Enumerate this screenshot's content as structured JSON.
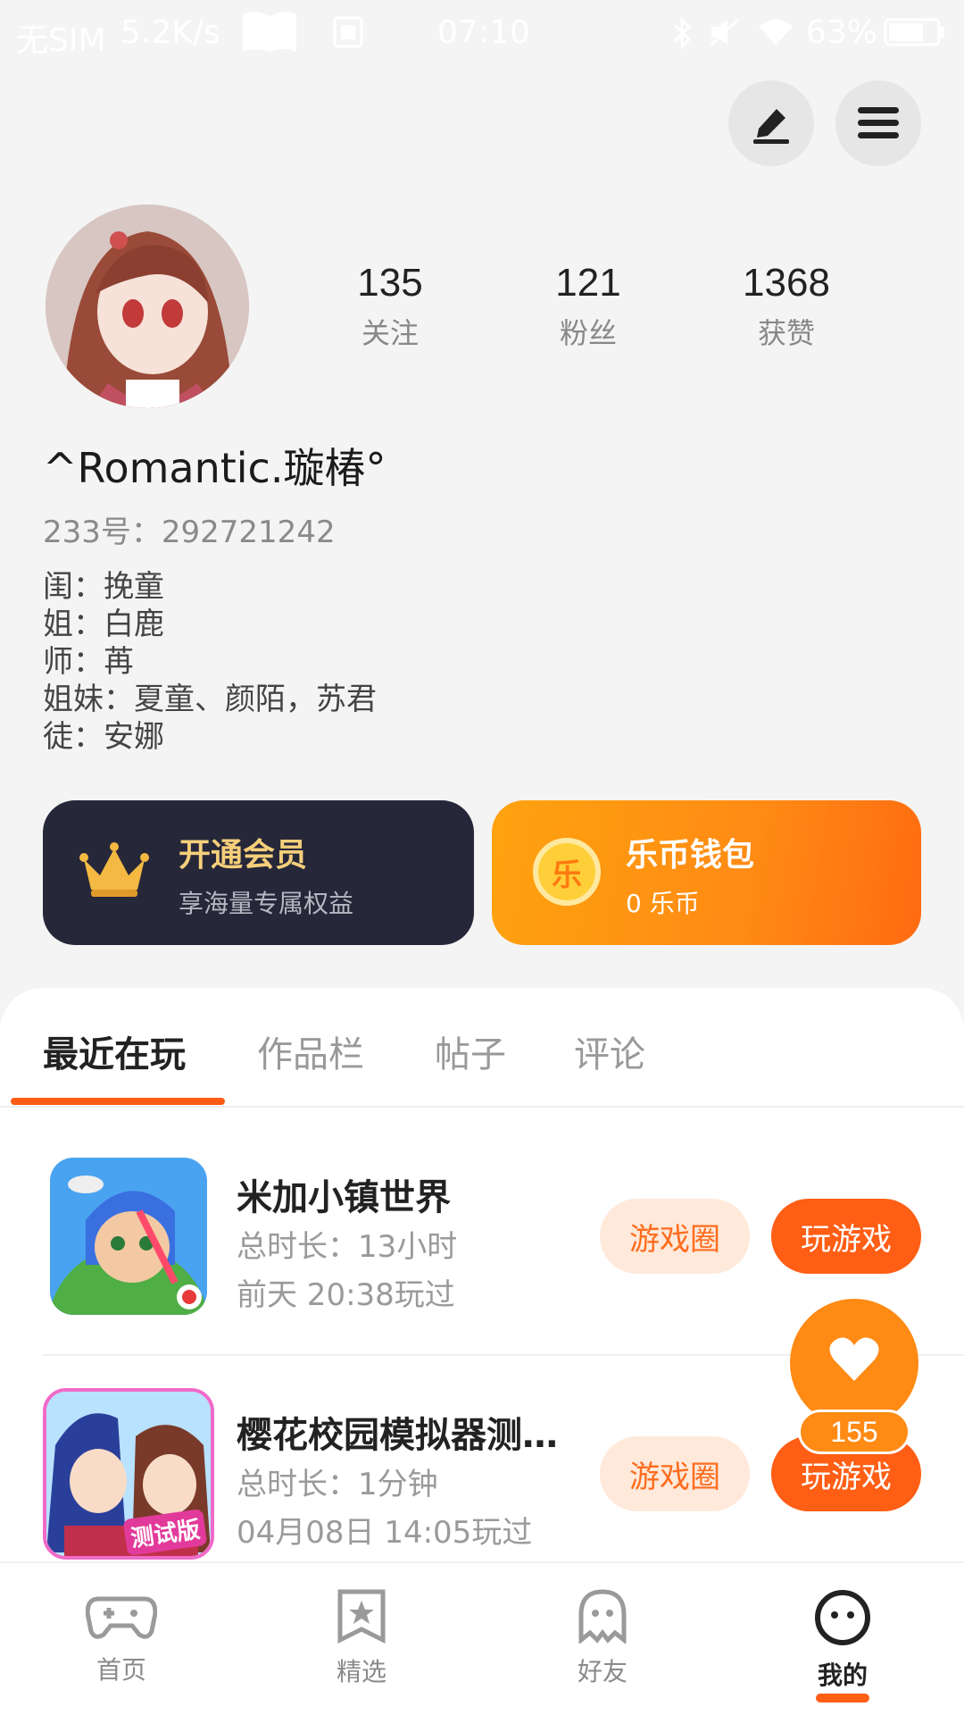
{
  "status_bar": {
    "carrier": "无SIM",
    "speed": "5.2K/s",
    "time": "07:10",
    "battery": "63%"
  },
  "header": {
    "edit_icon": "pen-icon",
    "menu_icon": "menu-icon"
  },
  "profile": {
    "stats": [
      {
        "value": "135",
        "label": "关注"
      },
      {
        "value": "121",
        "label": "粉丝"
      },
      {
        "value": "1368",
        "label": "获赞"
      }
    ],
    "username": "^Romantic.璇椿°",
    "id_line": "233号：292721242",
    "bio": [
      "闺：挽童",
      "姐：白鹿",
      "师：苒",
      "姐妹：夏童、颜陌，苏君",
      "徒：安娜"
    ]
  },
  "cards": {
    "vip": {
      "title": "开通会员",
      "subtitle": "享海量专属权益"
    },
    "coin": {
      "title": "乐币钱包",
      "subtitle": "0 乐币",
      "icon_text": "乐"
    }
  },
  "tabs": [
    "最近在玩",
    "作品栏",
    "帖子",
    "评论"
  ],
  "games": [
    {
      "title": "米加小镇世界",
      "duration": "总时长：13小时",
      "last_played": "前天 20:38玩过",
      "circle_label": "游戏圈",
      "play_label": "玩游戏"
    },
    {
      "title": "樱花校园模拟器测…",
      "duration": "总时长：1分钟",
      "last_played": "04月08日 14:05玩过",
      "circle_label": "游戏圈",
      "play_label": "玩游戏",
      "badge": "测试版"
    }
  ],
  "fab": {
    "count": "155",
    "icon": "heart-icon"
  },
  "nav": [
    {
      "label": "首页",
      "icon": "gamepad-icon"
    },
    {
      "label": "精选",
      "icon": "star-bookmark-icon"
    },
    {
      "label": "好友",
      "icon": "ghost-icon"
    },
    {
      "label": "我的",
      "icon": "smile-face-icon"
    }
  ],
  "colors": {
    "accent": "#ff5e15",
    "coin_gradient_start": "#ffa30f",
    "vip_bg": "#27273a"
  }
}
